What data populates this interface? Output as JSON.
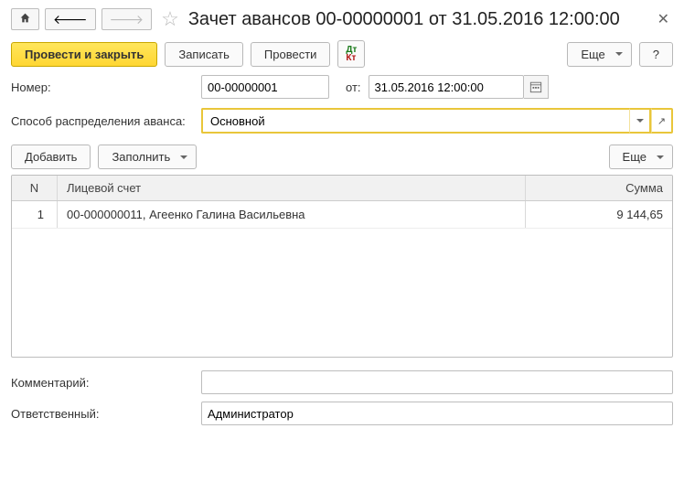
{
  "title": "Зачет авансов 00-00000001 от 31.05.2016 12:00:00",
  "toolbar": {
    "post_close": "Провести и закрыть",
    "save": "Записать",
    "post": "Провести",
    "more": "Еще",
    "help": "?"
  },
  "form": {
    "number_label": "Номер:",
    "number_value": "00-00000001",
    "from_label": "от:",
    "date_value": "31.05.2016 12:00:00",
    "distribution_label": "Способ распределения аванса:",
    "distribution_value": "Основной"
  },
  "table_toolbar": {
    "add": "Добавить",
    "fill": "Заполнить",
    "more": "Еще"
  },
  "table": {
    "columns": {
      "n": "N",
      "account": "Лицевой счет",
      "sum": "Сумма"
    },
    "rows": [
      {
        "n": "1",
        "account": "00-000000011, Агеенко Галина Васильевна",
        "sum": "9 144,65"
      }
    ]
  },
  "footer": {
    "comment_label": "Комментарий:",
    "comment_value": "",
    "responsible_label": "Ответственный:",
    "responsible_value": "Администратор"
  }
}
